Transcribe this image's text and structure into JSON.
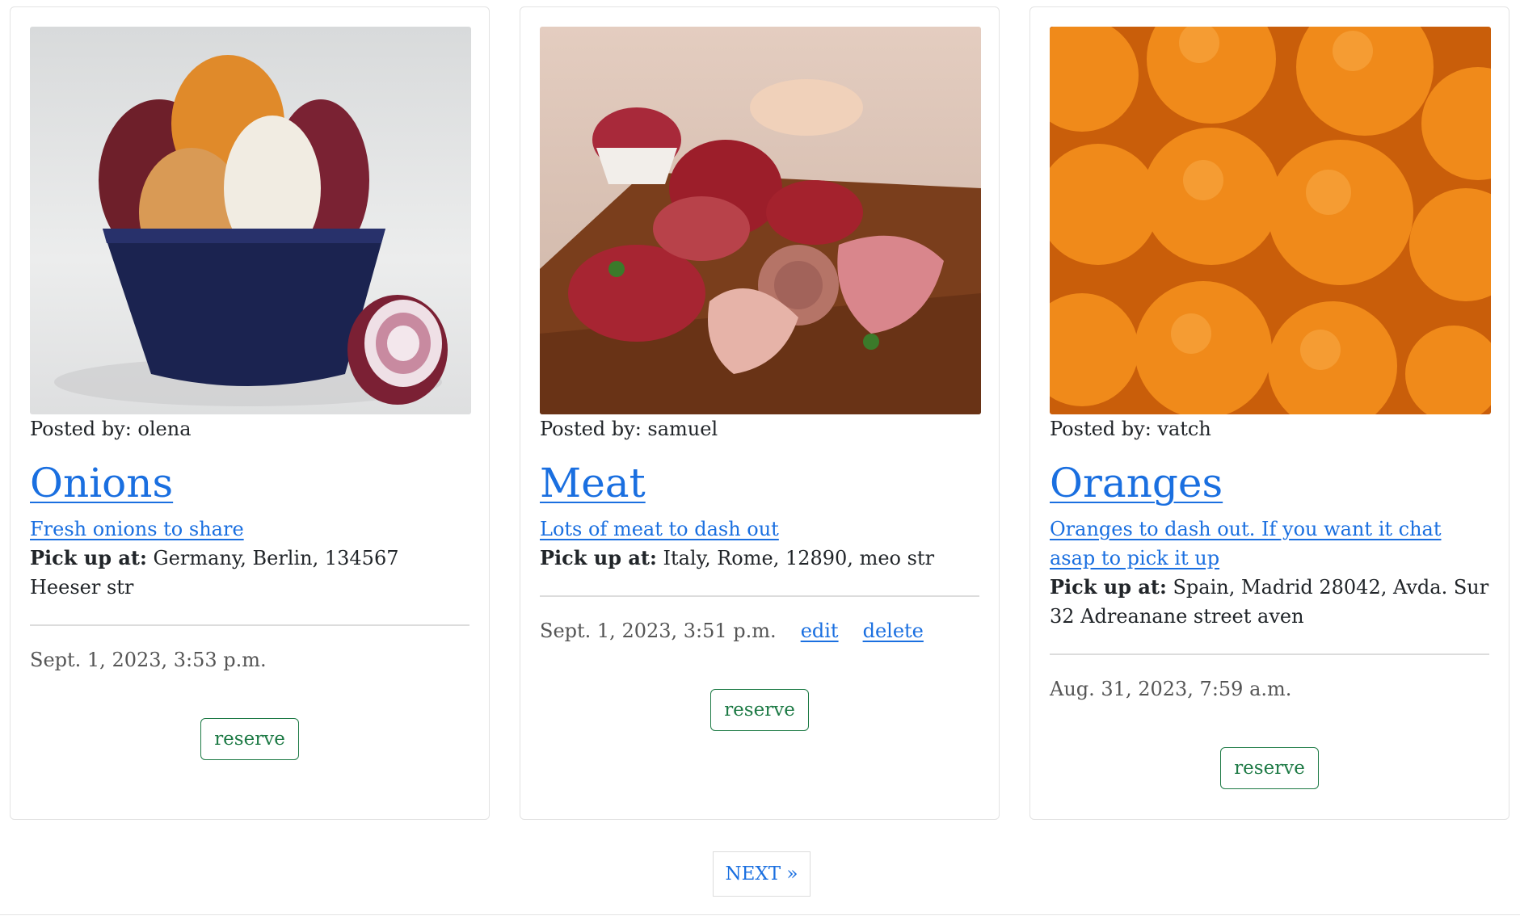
{
  "posts": [
    {
      "image": "onions-photo",
      "posted_by": "Posted by: olena",
      "title": "Onions",
      "description": "Fresh onions to share",
      "pickup_label": "Pick up at:",
      "pickup_address": "Germany, Berlin, 134567 Heeser str",
      "date": "Sept. 1, 2023, 3:53 p.m.",
      "reserve_label": "reserve"
    },
    {
      "image": "meat-photo",
      "posted_by": "Posted by: samuel",
      "title": "Meat",
      "description": "Lots of meat to dash out",
      "pickup_label": "Pick up at:",
      "pickup_address": "Italy, Rome, 12890, meo str",
      "date": "Sept. 1, 2023, 3:51 p.m.",
      "edit_label": "edit",
      "delete_label": "delete",
      "reserve_label": "reserve"
    },
    {
      "image": "oranges-photo",
      "posted_by": "Posted by: vatch",
      "title": "Oranges",
      "description": "Oranges to dash out. If you want it chat asap to pick it up",
      "pickup_label": "Pick up at:",
      "pickup_address": "Spain, Madrid 28042, Avda. Sur 32 Adreanane street aven",
      "date": "Aug. 31, 2023, 7:59 a.m.",
      "reserve_label": "reserve"
    }
  ],
  "pagination": {
    "next_label": "NEXT »"
  },
  "colors": {
    "link": "#1a6fe0",
    "reserve": "#1d7a45"
  }
}
